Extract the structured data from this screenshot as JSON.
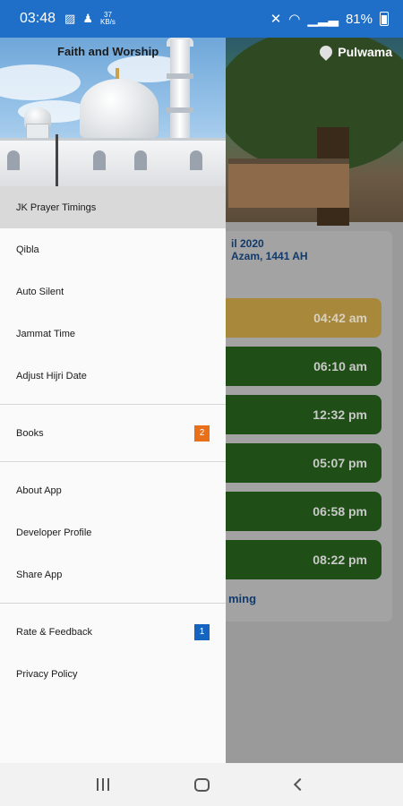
{
  "status_bar": {
    "time": "03:48",
    "speed_value": "37",
    "speed_unit": "KB/s",
    "battery": "81%"
  },
  "background_app": {
    "location": "Pulwama",
    "date_line1": "il 2020",
    "date_line2": "Azam, 1441 AH",
    "prayer_times": [
      "04:42 am",
      "06:10 am",
      "12:32 pm",
      "05:07 pm",
      "06:58 pm",
      "08:22 pm"
    ],
    "upcoming_label": "ming"
  },
  "drawer": {
    "header_title": "Faith and Worship",
    "groups": [
      [
        {
          "label": "JK Prayer Timings",
          "selected": true
        },
        {
          "label": "Qibla"
        },
        {
          "label": "Auto Silent"
        },
        {
          "label": "Jammat Time"
        },
        {
          "label": "Adjust Hijri Date"
        }
      ],
      [
        {
          "label": "Books",
          "badge": "2",
          "badge_color": "#e8701a"
        }
      ],
      [
        {
          "label": "About App"
        },
        {
          "label": "Developer Profile"
        },
        {
          "label": "Share App"
        }
      ],
      [
        {
          "label": "Rate & Feedback",
          "badge": "1",
          "badge_color": "#1565c0"
        },
        {
          "label": "Privacy Policy"
        }
      ]
    ]
  },
  "colors": {
    "status_bar": "#1f6fc8",
    "active_prayer": "#a8883a",
    "prayer_row": "#1f4f16",
    "selected_item": "#d9d9d9"
  }
}
